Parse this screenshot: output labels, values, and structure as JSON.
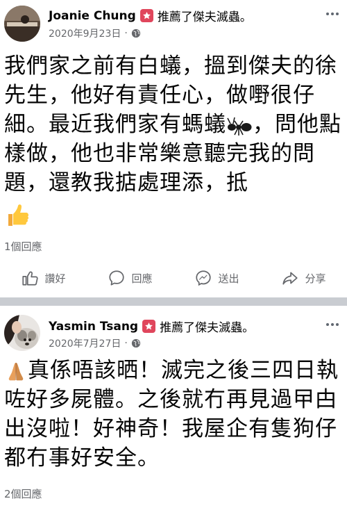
{
  "post1": {
    "author": "Joanie Chung",
    "recommend_text": "推薦了傑夫滅蟲。",
    "date": "2020年9月23日",
    "meta_dot": "·",
    "text_before_ant": "我們家之前有白蟻，搵到傑夫的徐先生，他好有責任心，做嘢很仔細。最近我們家有螞蟻",
    "text_after_ant": "，問他點樣做，他也非常樂意聽完我的問題，還教我掂處理添，抵",
    "reply_count": "1個回應",
    "actions": {
      "like": "讚好",
      "comment": "回應",
      "send": "送出",
      "share": "分享"
    },
    "icons": {
      "ant": "ant-icon",
      "thumbs": "thumbs-up-icon",
      "globe": "globe-icon"
    }
  },
  "post2": {
    "author": "Yasmin Tsang",
    "recommend_text": "推薦了傑夫滅蟲。",
    "date": "2020年7月27日",
    "meta_dot": "·",
    "text": "真係唔該晒！滅完之後三四日執咗好多屍體。之後就冇再見過曱甴出沒啦！好神奇！我屋企有隻狗仔都冇事好安全。",
    "reply_count": "2個回應",
    "icons": {
      "pray": "folded-hands-icon"
    }
  },
  "colors": {
    "badge": "#e0465c",
    "secondary_text": "#65676b",
    "divider": "#c9ccd1"
  }
}
